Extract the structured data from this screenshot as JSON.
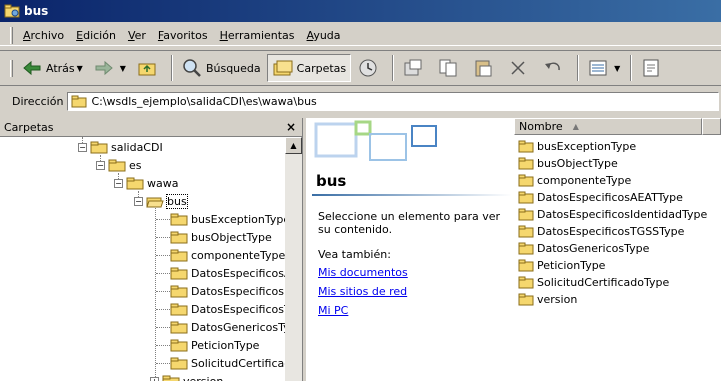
{
  "window": {
    "title": "bus"
  },
  "menu": [
    "Archivo",
    "Edición",
    "Ver",
    "Favoritos",
    "Herramientas",
    "Ayuda"
  ],
  "toolbar": {
    "back_label": "Atrás",
    "search_label": "Búsqueda",
    "folders_label": "Carpetas"
  },
  "address": {
    "label": "Dirección",
    "value": "C:\\wsdls_ejemplo\\salidaCDI\\es\\wawa\\bus"
  },
  "left_pane": {
    "title": "Carpetas",
    "close": "×",
    "tree": [
      "salidaCDI",
      "es",
      "wawa",
      "bus",
      "busExceptionType",
      "busObjectType",
      "componenteType",
      "DatosEspecificosA",
      "DatosEspecificosI",
      "DatosEspecificosT",
      "DatosGenericosTy",
      "PeticionType",
      "SolicitudCertificad",
      "version"
    ]
  },
  "web_pane": {
    "folder_title": "bus",
    "description": "Seleccione un elemento para ver su contenido.",
    "see_also": "Vea también:",
    "links": [
      "Mis documentos",
      "Mis sitios de red",
      "Mi PC"
    ]
  },
  "file_list": {
    "column_name": "Nombre",
    "sort_indicator": "▲",
    "items": [
      "busExceptionType",
      "busObjectType",
      "componenteType",
      "DatosEspecificosAEATType",
      "DatosEspecificosIdentidadType",
      "DatosEspecificosTGSSType",
      "DatosGenericosType",
      "PeticionType",
      "SolicitudCertificadoType",
      "version"
    ]
  },
  "colors": {
    "titlebar": "#0a246a",
    "folder": "#f5d76e",
    "link": "#0000ee"
  }
}
